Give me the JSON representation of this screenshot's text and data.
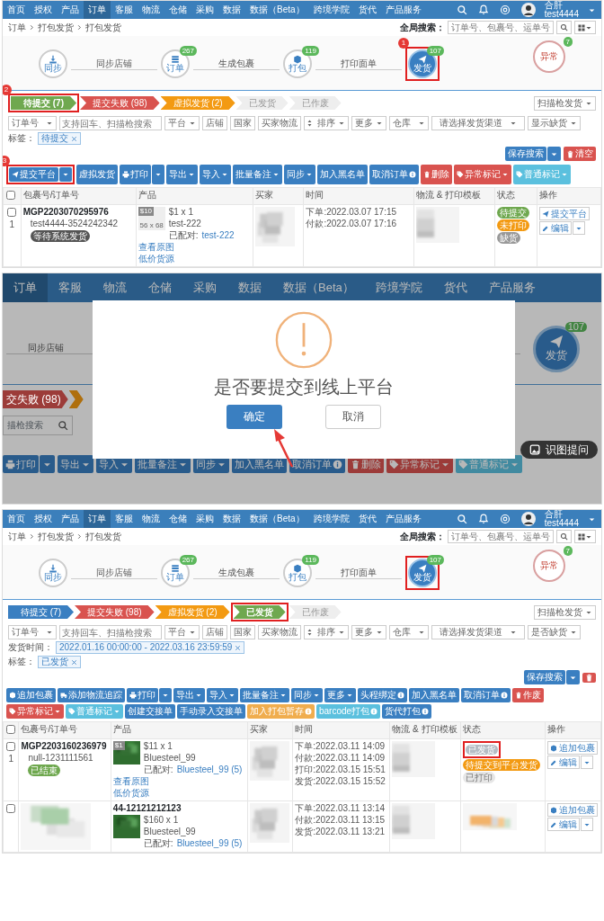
{
  "screens": [
    {
      "kind": "page",
      "nav": {
        "items": [
          {
            "label": "首页",
            "selected": false
          },
          {
            "label": "授权",
            "selected": false
          },
          {
            "label": "产品",
            "selected": false
          },
          {
            "label": "订单",
            "selected": true
          },
          {
            "label": "客服",
            "selected": false
          },
          {
            "label": "物流",
            "selected": false
          },
          {
            "label": "仓储",
            "selected": false
          },
          {
            "label": "采购",
            "selected": false
          },
          {
            "label": "数据",
            "selected": false
          },
          {
            "label": "数据（Beta）",
            "selected": false
          },
          {
            "label": "跨境学院",
            "selected": false
          },
          {
            "label": "货代",
            "selected": false
          },
          {
            "label": "产品服务",
            "selected": false
          }
        ],
        "user": {
          "name": "合肝",
          "account": "test4444"
        }
      },
      "breadcrumb": [
        "订单",
        "打包发货",
        "打包发货"
      ],
      "global_search": {
        "label": "全局搜索：",
        "placeholder": "订单号、包裹号、运单号"
      },
      "steps": [
        {
          "kind": "sync",
          "label": "同步",
          "selected": false,
          "highlighted": false,
          "link_label": "同步店铺"
        },
        {
          "kind": "orders",
          "label": "订单",
          "badge": "267",
          "selected": false,
          "highlighted": false,
          "link_label": "生成包裹"
        },
        {
          "kind": "pack",
          "label": "打包",
          "badge": "119",
          "selected": false,
          "highlighted": false,
          "link_label": "打印面单"
        },
        {
          "kind": "ship",
          "label": "发货",
          "badge": "107",
          "selected": true,
          "highlighted": true,
          "callout": "1"
        },
        {
          "kind": "alert",
          "label": "异常",
          "badge": "7",
          "selected": false,
          "highlighted": false
        }
      ],
      "status_tabs": [
        {
          "label": "待提交 (7)",
          "color": "#6fa84f",
          "selected": true,
          "highlighted": true,
          "callout": "2"
        },
        {
          "label": "提交失败 (98)",
          "color": "#d9534f",
          "selected": false,
          "highlighted": false
        },
        {
          "label": "虚拟发货 (2)",
          "color": "#f39a12",
          "selected": false,
          "highlighted": false
        },
        {
          "label": "已发货",
          "color": "#eeeeee",
          "selected": false,
          "highlighted": false
        },
        {
          "label": "已作废",
          "color": "#eeeeee",
          "selected": false,
          "highlighted": false
        }
      ],
      "scan_button": "扫描枪发货",
      "filters": [
        {
          "kind": "select",
          "label": "订单号"
        },
        {
          "kind": "search",
          "placeholder": "支持回车、扫描枪搜索"
        },
        {
          "kind": "button",
          "label": "平台",
          "caret": true
        },
        {
          "kind": "button",
          "label": "店铺",
          "caret": false
        },
        {
          "kind": "button",
          "label": "国家",
          "caret": false
        },
        {
          "kind": "button",
          "label": "买家物流",
          "caret": false
        },
        {
          "kind": "sort",
          "label": "排序",
          "caret": true
        },
        {
          "kind": "button",
          "label": "更多",
          "caret": true
        },
        {
          "kind": "select",
          "label": "仓库"
        },
        {
          "kind": "wideselect",
          "label": "请选择发货渠道"
        },
        {
          "kind": "button",
          "label": "显示缺货",
          "caret": true
        }
      ],
      "tags": [
        {
          "label": "标签：",
          "value": "待提交"
        }
      ],
      "save_search": "保存搜索",
      "clear": "清空",
      "toolbar": [
        {
          "kind": "submit",
          "label": "提交平台",
          "highlighted": true,
          "callout": "3"
        },
        {
          "kind": "plain",
          "label": "虚拟发货",
          "highlighted": false
        },
        {
          "kind": "print",
          "label": "打印",
          "highlighted": false
        },
        {
          "kind": "menu",
          "label": "导出",
          "highlighted": false
        },
        {
          "kind": "menu",
          "label": "导入",
          "highlighted": false
        },
        {
          "kind": "menu",
          "label": "批量备注",
          "highlighted": false
        },
        {
          "kind": "menu",
          "label": "同步",
          "highlighted": false
        },
        {
          "kind": "plain",
          "label": "加入黑名单",
          "highlighted": false
        },
        {
          "kind": "notice",
          "label": "取消订单",
          "highlighted": false
        },
        {
          "kind": "delete",
          "label": "删除",
          "highlighted": false
        },
        {
          "kind": "flag",
          "label": "异常标记",
          "highlighted": false
        },
        {
          "kind": "mark",
          "label": "普通标记",
          "highlighted": false
        }
      ],
      "table": {
        "select_all_checked": false,
        "columns": [
          "包裹号/订单号",
          "产品",
          "买家",
          "时间",
          "物流 & 打印模板",
          "状态",
          "操作"
        ],
        "rows": [
          {
            "number": "1",
            "checked": false,
            "ids": {
              "package_id": "MGP2203070295976",
              "order_id": "test4444-3524242342",
              "badge": {
                "label": "等待系统发货",
                "color": "#555555"
              }
            },
            "product": {
              "thumb": {
                "kind": "placeholder",
                "size": "56 x 68",
                "tag": "$10"
              },
              "title": "$1 x 1",
              "sku": "test-222",
              "paired_label": "已配对:",
              "paired_value": "test-222",
              "links": [
                "查看原图",
                "低价货源"
              ]
            },
            "buyer": {
              "kind": "picture"
            },
            "times": [
              "下单:2022.03.07 17:15",
              "付款:2022.03.07 17:16"
            ],
            "logistics": {
              "kind": "picture"
            },
            "status": {
              "badges": [
                {
                  "label": "待提交",
                  "color": "#6fa84f",
                  "highlighted": false
                },
                {
                  "label": "未打印",
                  "color": "#f39a12",
                  "highlighted": false
                },
                {
                  "label": "缺货",
                  "color": "#999999",
                  "highlighted": false
                }
              ]
            },
            "actions": [
              {
                "kind": "submit",
                "label": "提交平台",
                "caret": false
              },
              {
                "kind": "edit",
                "label": "编辑",
                "caret": true
              }
            ]
          }
        ]
      }
    },
    {
      "kind": "dialog",
      "nav": {
        "items": [
          {
            "label": "订单",
            "selected": true
          },
          {
            "label": "客服",
            "selected": false
          },
          {
            "label": "物流",
            "selected": false
          },
          {
            "label": "仓储",
            "selected": false
          },
          {
            "label": "采购",
            "selected": false
          },
          {
            "label": "数据",
            "selected": false
          },
          {
            "label": "数据（Beta）",
            "selected": false
          },
          {
            "label": "跨境学院",
            "selected": false
          },
          {
            "label": "货代",
            "selected": false
          },
          {
            "label": "产品服务",
            "selected": false
          }
        ]
      },
      "step_link": "同步店铺",
      "step": {
        "label": "发货",
        "badge": "107",
        "selected": true
      },
      "tabs": [
        {
          "label": "交失败 (98)",
          "color": "#9c3c39"
        },
        {
          "color": "#af6f0d"
        }
      ],
      "search_placeholder": "描枪搜索",
      "toolbar": [
        {
          "kind": "print",
          "label": "打印"
        },
        {
          "kind": "menu",
          "label": "导出"
        },
        {
          "kind": "menu",
          "label": "导入"
        },
        {
          "kind": "menu",
          "label": "批量备注"
        },
        {
          "kind": "menu",
          "label": "同步"
        },
        {
          "kind": "plain",
          "label": "加入黑名单"
        },
        {
          "kind": "notice",
          "label": "取消订单"
        },
        {
          "kind": "delete",
          "label": "删除"
        },
        {
          "kind": "flag",
          "label": "异常标记"
        },
        {
          "kind": "mark",
          "label": "普通标记"
        }
      ],
      "dialog": {
        "message": "是否要提交到线上平台",
        "confirm": "确定",
        "cancel": "取消"
      },
      "assist_button": "识图提问"
    },
    {
      "kind": "page",
      "nav": {
        "items": [
          {
            "label": "首页",
            "selected": false
          },
          {
            "label": "授权",
            "selected": false
          },
          {
            "label": "产品",
            "selected": false
          },
          {
            "label": "订单",
            "selected": true
          },
          {
            "label": "客服",
            "selected": false
          },
          {
            "label": "物流",
            "selected": false
          },
          {
            "label": "仓储",
            "selected": false
          },
          {
            "label": "采购",
            "selected": false
          },
          {
            "label": "数据",
            "selected": false
          },
          {
            "label": "数据（Beta）",
            "selected": false
          },
          {
            "label": "跨境学院",
            "selected": false
          },
          {
            "label": "货代",
            "selected": false
          },
          {
            "label": "产品服务",
            "selected": false
          }
        ],
        "user": {
          "name": "合肝",
          "account": "test4444"
        }
      },
      "breadcrumb": [
        "订单",
        "打包发货",
        "打包发货"
      ],
      "global_search": {
        "label": "全局搜索：",
        "placeholder": "订单号、包裹号、运单号"
      },
      "steps": [
        {
          "kind": "sync",
          "label": "同步",
          "selected": false,
          "highlighted": false,
          "link_label": "同步店铺"
        },
        {
          "kind": "orders",
          "label": "订单",
          "badge": "267",
          "selected": false,
          "highlighted": false,
          "link_label": "生成包裹"
        },
        {
          "kind": "pack",
          "label": "打包",
          "badge": "119",
          "selected": false,
          "highlighted": false,
          "link_label": "打印面单"
        },
        {
          "kind": "ship",
          "label": "发货",
          "badge": "107",
          "selected": true,
          "highlighted": true
        },
        {
          "kind": "alert",
          "label": "异常",
          "badge": "7",
          "selected": false,
          "highlighted": false
        }
      ],
      "status_tabs": [
        {
          "label": "待提交 (7)",
          "color": "#3a7fc1",
          "selected": false,
          "highlighted": false
        },
        {
          "label": "提交失败 (98)",
          "color": "#d9534f",
          "selected": false,
          "highlighted": false
        },
        {
          "label": "虚拟发货 (2)",
          "color": "#f39a12",
          "selected": false,
          "highlighted": false
        },
        {
          "label": "已发货",
          "color": "#6fa84f",
          "selected": true,
          "highlighted": true
        },
        {
          "label": "已作废",
          "color": "#eeeeee",
          "selected": false,
          "highlighted": false
        }
      ],
      "scan_button": "扫描枪发货",
      "filters": [
        {
          "kind": "select",
          "label": "订单号"
        },
        {
          "kind": "search",
          "placeholder": "支持回车、扫描枪搜索"
        },
        {
          "kind": "button",
          "label": "平台",
          "caret": true
        },
        {
          "kind": "button",
          "label": "店铺",
          "caret": false
        },
        {
          "kind": "button",
          "label": "国家",
          "caret": false
        },
        {
          "kind": "button",
          "label": "买家物流",
          "caret": false
        },
        {
          "kind": "sort",
          "label": "排序",
          "caret": true
        },
        {
          "kind": "button",
          "label": "更多",
          "caret": true
        },
        {
          "kind": "select",
          "label": "仓库"
        },
        {
          "kind": "wideselect",
          "label": "请选择发货渠道"
        },
        {
          "kind": "button",
          "label": "是否缺货",
          "caret": true
        }
      ],
      "tags": [
        {
          "label": "发货时间：",
          "value": "2022.01.16 00:00:00 - 2022.03.16 23:59:59"
        },
        {
          "label": "标签：",
          "value": "已发货"
        }
      ],
      "save_search": "保存搜索",
      "toolbar": [
        {
          "kind": "package",
          "label": "追加包裹"
        },
        {
          "kind": "track",
          "label": "添加物流追踪"
        },
        {
          "kind": "print",
          "label": "打印"
        },
        {
          "kind": "menu",
          "label": "导出"
        },
        {
          "kind": "menu",
          "label": "导入"
        },
        {
          "kind": "menu",
          "label": "批量备注"
        },
        {
          "kind": "menu",
          "label": "同步"
        },
        {
          "kind": "menu",
          "label": "更多"
        },
        {
          "kind": "notice",
          "label": "头程绑定"
        },
        {
          "kind": "plain",
          "label": "加入黑名单"
        },
        {
          "kind": "notice",
          "label": "取消订单"
        },
        {
          "kind": "delete",
          "label": "作废"
        },
        {
          "kind": "flag",
          "label": "异常标记"
        },
        {
          "kind": "mark",
          "label": "普通标记"
        },
        {
          "kind": "plain",
          "label": "创建交接单"
        },
        {
          "kind": "plain",
          "label": "手动录入交接单"
        },
        {
          "kind": "hold",
          "label": "加入打包暂存"
        },
        {
          "kind": "barcode",
          "label": "barcode打包"
        },
        {
          "kind": "notice",
          "label": "货代打包"
        }
      ],
      "table": {
        "select_all_checked": false,
        "columns": [
          "包裹号/订单号",
          "产品",
          "买家",
          "时间",
          "物流 & 打印模板",
          "状态",
          "操作"
        ],
        "rows": [
          {
            "number": "1",
            "checked": false,
            "ids": {
              "package_id": "MGP2203160236979",
              "order_id": "null-1231111561",
              "badge": {
                "label": "已结束",
                "color": "#6fa84f"
              }
            },
            "product": {
              "thumb": {
                "kind": "picture",
                "tag": "$1"
              },
              "title": "$11 x 1",
              "sku": "Bluesteel_99",
              "paired_label": "已配对:",
              "paired_value": "Bluesteel_99 (5)",
              "links": [
                "查看原图",
                "低价货源"
              ]
            },
            "buyer": {
              "kind": "picture"
            },
            "times": [
              "下单:2022.03.11 14:09",
              "付款:2022.03.11 14:09",
              "打印:2022.03.15 15:51",
              "发货:2022.03.15 15:52"
            ],
            "logistics": {
              "kind": "picture"
            },
            "status": {
              "badges": [
                {
                  "label": "已发货",
                  "color": "#b5bcc4",
                  "highlighted": true
                },
                {
                  "label": "待提交到平台发货",
                  "color": "#f39a12",
                  "highlighted": false
                },
                {
                  "label": "已打印",
                  "color": "#e6e6e6",
                  "highlighted": false
                }
              ]
            },
            "actions": [
              {
                "kind": "package",
                "label": "追加包裹",
                "caret": false
              },
              {
                "kind": "edit",
                "label": "编辑",
                "caret": true
              }
            ]
          },
          {
            "checked": false,
            "ids": {
              "kind": "picture"
            },
            "product": {
              "heading": "44-12121212123",
              "thumb": {
                "kind": "picture"
              },
              "title": "$160 x 1",
              "sku": "Bluesteel_99",
              "paired_label": "已配对:",
              "paired_value": "Bluesteel_99 (5)"
            },
            "buyer": {
              "kind": "picture"
            },
            "times": [
              "下单:2022.03.11 13:14",
              "付款:2022.03.11 13:15",
              "发货:2022.03.11 13:21"
            ],
            "logistics": {
              "kind": "picture"
            },
            "status": {
              "kind": "picture"
            },
            "actions": [
              {
                "kind": "package",
                "label": "追加包裹",
                "caret": false
              },
              {
                "kind": "edit",
                "label": "编辑",
                "caret": true
              }
            ]
          }
        ]
      }
    }
  ]
}
